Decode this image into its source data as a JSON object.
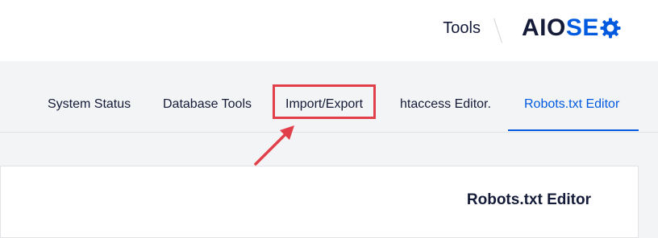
{
  "header": {
    "page_label": "Tools",
    "logo": {
      "part1": "AIO",
      "part2": "SE",
      "icon": "gear-icon",
      "brand_dark": "#141b38",
      "brand_blue": "#005ae0"
    }
  },
  "tabs": [
    {
      "label": "System Status",
      "active": false
    },
    {
      "label": "Database Tools",
      "active": false
    },
    {
      "label": "Import/Export",
      "active": false,
      "highlighted": true
    },
    {
      "label": "htaccess Editor.",
      "active": false
    },
    {
      "label": "Robots.txt Editor",
      "active": true
    }
  ],
  "annotation": {
    "highlight_color": "#e1404b",
    "icon": "arrow-icon"
  },
  "card": {
    "title": "Robots.txt Editor"
  }
}
